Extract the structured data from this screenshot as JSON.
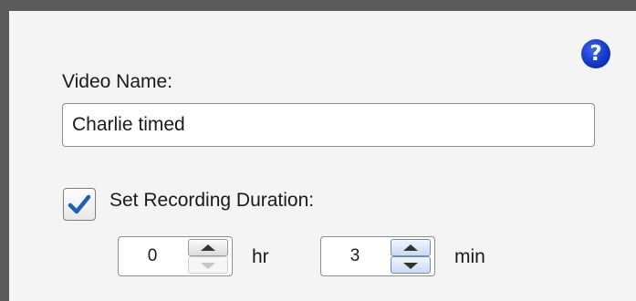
{
  "form": {
    "video_name_label": "Video Name:",
    "video_name_value": "Charlie timed",
    "help_icon": "?",
    "recording_duration_label": "Set Recording Duration:",
    "recording_duration_checked": true
  },
  "duration": {
    "hours_value": "0",
    "hours_unit": "hr",
    "minutes_value": "3",
    "minutes_unit": "min"
  },
  "icons": {
    "help": "question-circle-icon",
    "check": "checkmark-icon",
    "up": "chevron-up-icon",
    "down": "chevron-down-icon"
  },
  "colors": {
    "help_icon": "#1233c2",
    "checkmark": "#1f5fb8",
    "window_frame": "#5a5a5a",
    "panel_background": "#f4f4f4"
  }
}
